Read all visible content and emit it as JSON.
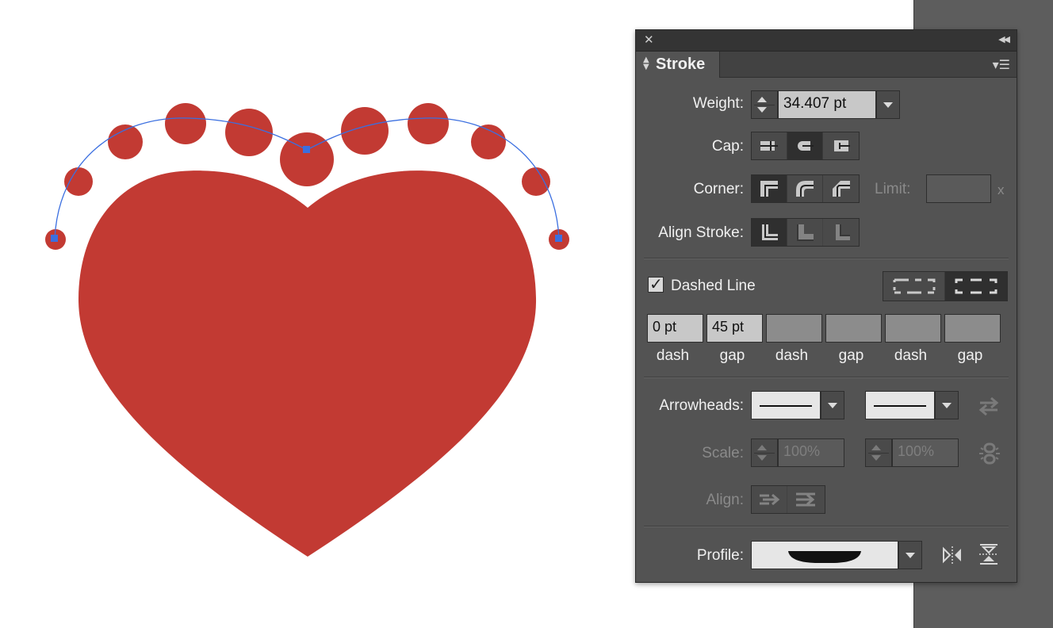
{
  "panel": {
    "tab_title": "Stroke",
    "weight_label": "Weight:",
    "weight_value": "34.407 pt",
    "cap_label": "Cap:",
    "corner_label": "Corner:",
    "limit_label": "Limit:",
    "limit_value": "",
    "limit_unit": "x",
    "align_stroke_label": "Align Stroke:",
    "dashed_line_label": "Dashed Line",
    "dashed_line_checked": true,
    "dash_values": [
      "0 pt",
      "45 pt",
      "",
      "",
      "",
      ""
    ],
    "dash_labels": [
      "dash",
      "gap",
      "dash",
      "gap",
      "dash",
      "gap"
    ],
    "arrowheads_label": "Arrowheads:",
    "scale_label": "Scale:",
    "scale_start": "100%",
    "scale_end": "100%",
    "align_label": "Align:",
    "profile_label": "Profile:"
  },
  "colors": {
    "heart": "#c23a33",
    "path": "#3b6fe0",
    "panel": "#535353"
  },
  "icons": {
    "close": "close-icon",
    "collapse": "collapse-icon",
    "menu": "panel-menu-icon",
    "swap": "swap-arrowheads-icon",
    "link": "link-scale-icon",
    "flip_h": "flip-along-icon",
    "flip_v": "flip-across-icon"
  }
}
